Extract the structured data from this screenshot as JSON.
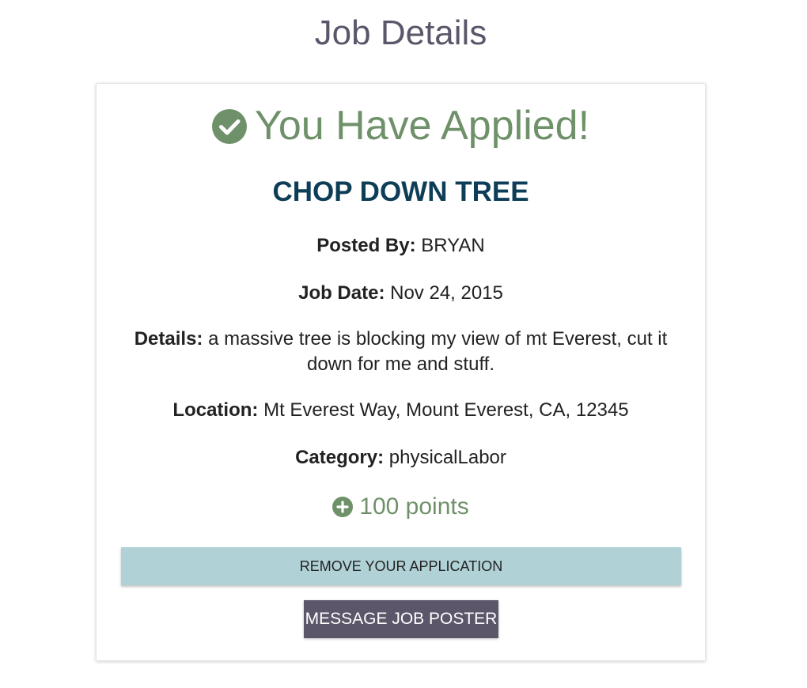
{
  "page": {
    "title": "Job Details"
  },
  "status": {
    "text": "You Have Applied!",
    "icon": "check-circle-icon",
    "color": "#6f9169"
  },
  "job": {
    "title": "CHOP DOWN TREE",
    "title_color": "#0d3d57",
    "posted_by_label": "Posted By:",
    "posted_by": "BRYAN",
    "date_label": "Job Date:",
    "date": "Nov 24, 2015",
    "details_label": "Details:",
    "details": "a massive tree is blocking my view of mt Everest, cut it down for me and stuff.",
    "location_label": "Location:",
    "location": "Mt Everest Way, Mount Everest, CA, 12345",
    "category_label": "Category:",
    "category": "physicalLabor",
    "points": "100 points",
    "points_icon": "plus-circle-icon"
  },
  "actions": {
    "remove_label": "REMOVE YOUR APPLICATION",
    "remove_color": "#b0d1d6",
    "message_label": "MESSAGE JOB POSTER",
    "message_color": "#5b566a"
  }
}
